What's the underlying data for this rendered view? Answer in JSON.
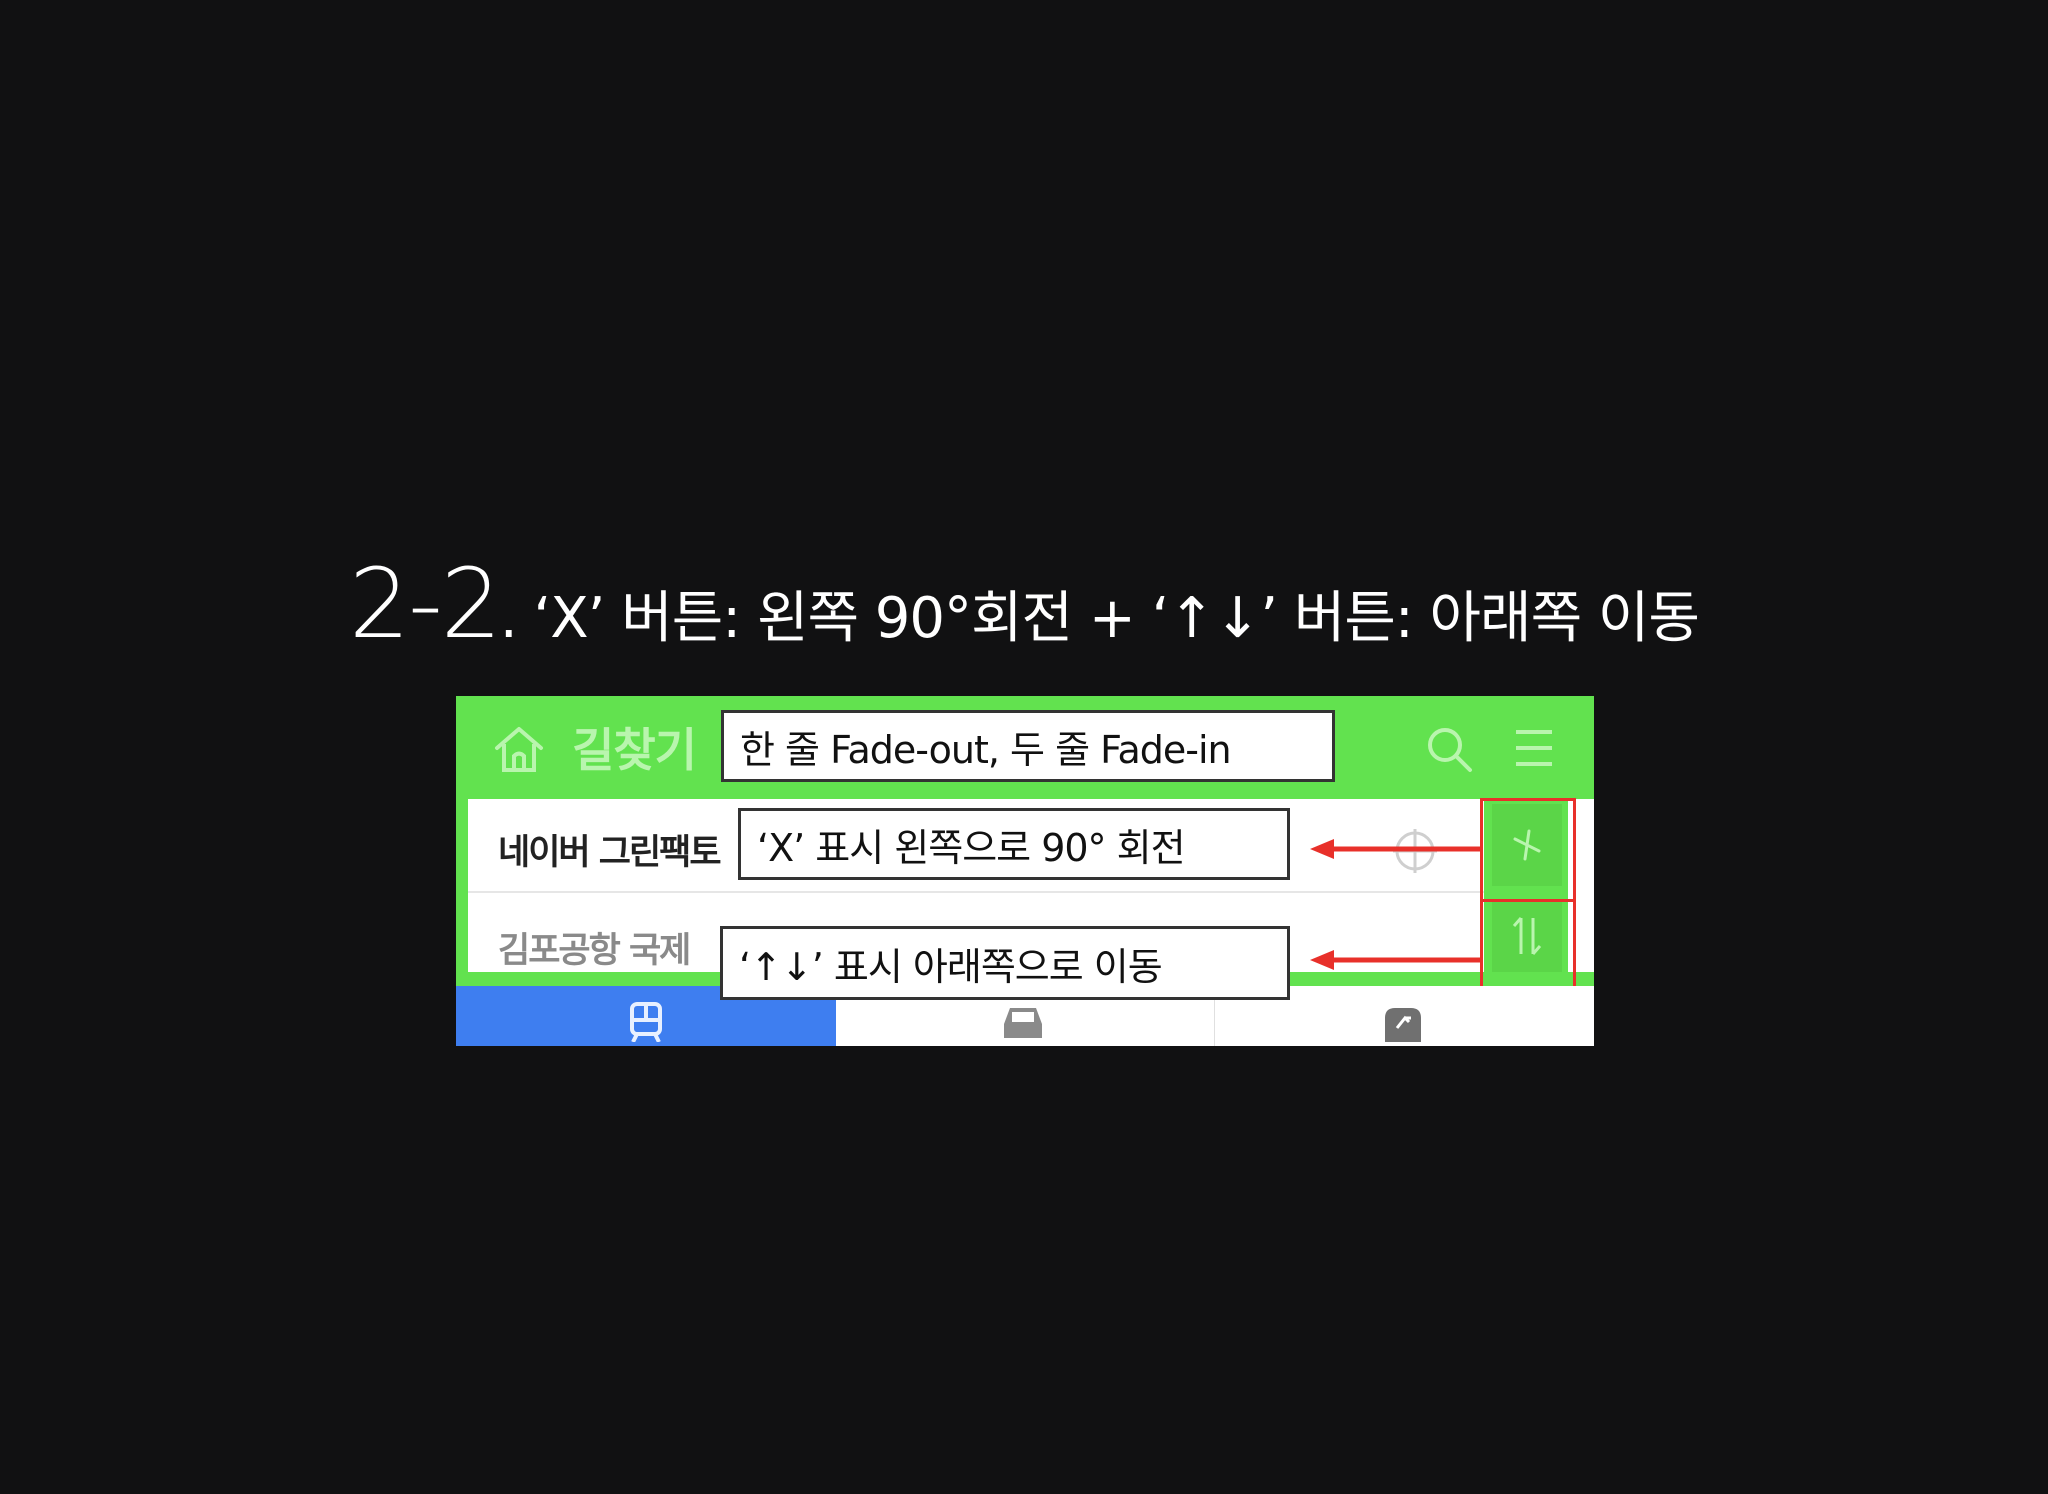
{
  "slide": {
    "title_number": "2-2",
    "title_text": ". ‘X’ 버튼: 왼쪽 90°회전 + ‘↑↓’ 버튼: 아래쪽 이동"
  },
  "app": {
    "title": "길찾기",
    "route_from": "네이버 그린팩토",
    "route_to": "김포공항 국제"
  },
  "callouts": {
    "header_fade": "한 줄 Fade-out, 두 줄 Fade-in",
    "x_rotate": "‘X’ 표시 왼쪽으로 90° 회전",
    "swap_move": "‘↑↓’ 표시 아래쪽으로 이동"
  },
  "colors": {
    "background": "#111112",
    "app_green": "#62e24f",
    "highlight_red": "#e8302a",
    "tab_active_blue": "#3e7ef0"
  },
  "icons": [
    "home-icon",
    "search-icon",
    "menu-icon",
    "locate-icon",
    "close-icon",
    "swap-icon",
    "train-icon",
    "car-icon",
    "walk-icon"
  ]
}
